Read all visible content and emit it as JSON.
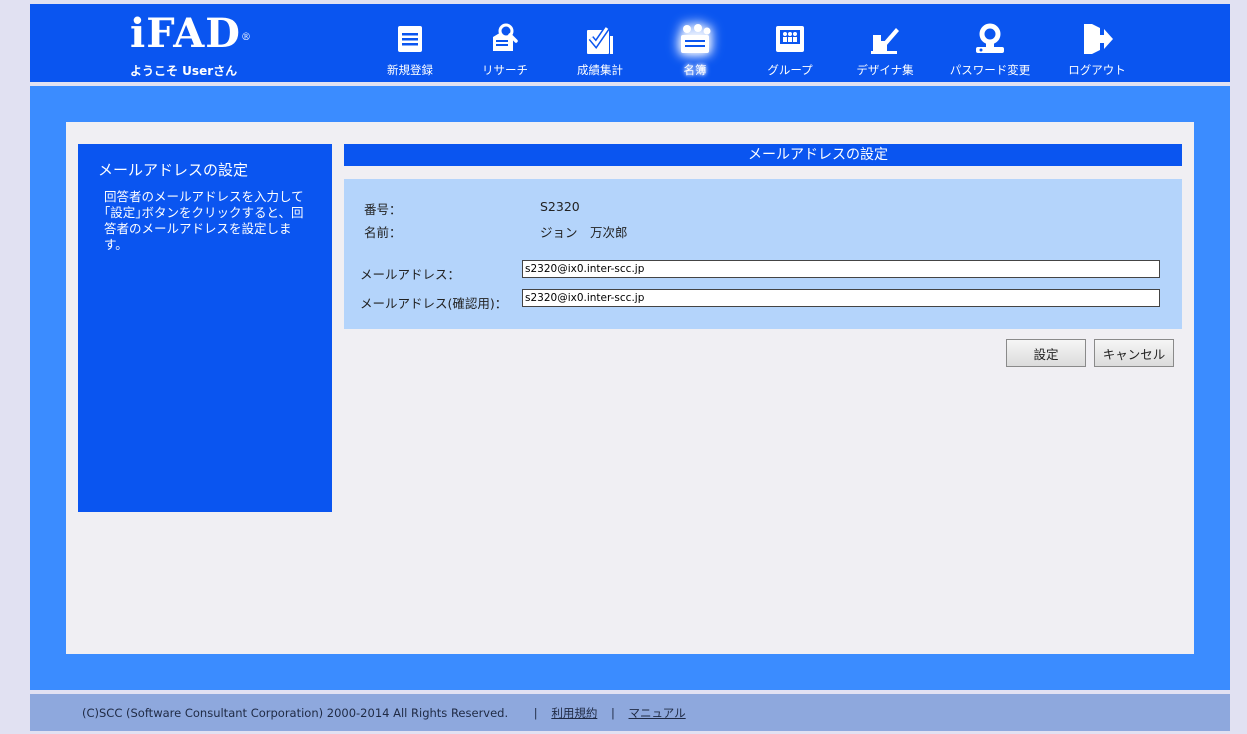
{
  "header": {
    "logo": "iFAD",
    "logo_mark": "®",
    "welcome": "ようこそ Userさん"
  },
  "nav": [
    {
      "label": "新規登録",
      "icon": "document-icon"
    },
    {
      "label": "リサーチ",
      "icon": "research-icon"
    },
    {
      "label": "成績集計",
      "icon": "results-icon"
    },
    {
      "label": "名簿",
      "icon": "roster-icon",
      "active": true
    },
    {
      "label": "グループ",
      "icon": "group-icon"
    },
    {
      "label": "デザイナ集",
      "icon": "designer-icon"
    },
    {
      "label": "パスワード変更",
      "icon": "password-key-icon"
    },
    {
      "label": "ログアウト",
      "icon": "logout-icon"
    }
  ],
  "sidebar": {
    "title": "メールアドレスの設定",
    "description": "回答者のメールアドレスを入力して｢設定｣ボタンをクリックすると、回答者のメールアドレスを設定します。"
  },
  "main": {
    "title": "メールアドレスの設定",
    "number_label": "番号：",
    "number_value": "S2320",
    "name_label": "名前：",
    "name_value": "ジョン　万次郎",
    "email_label": "メールアドレス：",
    "email_value": "s2320@ix0.inter-scc.jp",
    "email_confirm_label": "メールアドレス(確認用)：",
    "email_confirm_value": "s2320@ix0.inter-scc.jp",
    "submit_label": "設定",
    "cancel_label": "キャンセル"
  },
  "footer": {
    "copyright": "(C)SCC (Software Consultant Corporation) 2000-2014 All Rights Reserved.",
    "terms_link": "利用規約",
    "manual_link": "マニュアル",
    "separator": "|"
  },
  "colors": {
    "header_blue": "#0a55f0",
    "frame_blue": "#3b8cff",
    "form_bg": "#b4d4fb",
    "footer_bg": "#8ea8dd"
  }
}
